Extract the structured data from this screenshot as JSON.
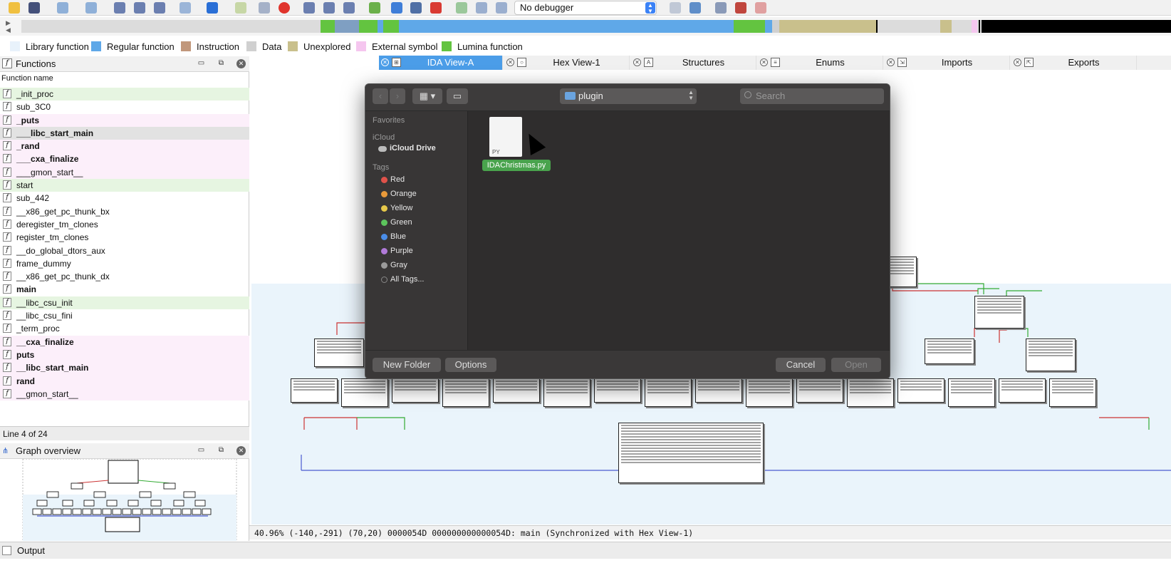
{
  "toolbar": {
    "debugger_select": "No debugger",
    "icons": [
      "open-icon",
      "save-icon",
      "back-icon",
      "forward-icon",
      "toolbar-action-icon",
      "run-icon",
      "pause-icon",
      "stop-icon",
      "breakpoint-icon"
    ]
  },
  "legend": [
    {
      "label": "Library function",
      "color": "#e8f2fb"
    },
    {
      "label": "Regular function",
      "color": "#5fa8e8"
    },
    {
      "label": "Instruction",
      "color": "#c1977b"
    },
    {
      "label": "Data",
      "color": "#d0d0d0"
    },
    {
      "label": "Unexplored",
      "color": "#c9c08c"
    },
    {
      "label": "External symbol",
      "color": "#f5c6ef"
    },
    {
      "label": "Lumina function",
      "color": "#63c440"
    }
  ],
  "functions_panel": {
    "title": "Functions",
    "column_header": "Function name",
    "items": [
      {
        "name": "_init_proc",
        "kind": "lib"
      },
      {
        "name": "sub_3C0",
        "kind": "plain"
      },
      {
        "name": "_puts",
        "kind": "imp_bold"
      },
      {
        "name": "___libc_start_main",
        "kind": "sel_bold"
      },
      {
        "name": "_rand",
        "kind": "imp_bold"
      },
      {
        "name": "___cxa_finalize",
        "kind": "imp_bold"
      },
      {
        "name": "___gmon_start__",
        "kind": "imp"
      },
      {
        "name": "start",
        "kind": "lib"
      },
      {
        "name": "sub_442",
        "kind": "plain"
      },
      {
        "name": "__x86_get_pc_thunk_bx",
        "kind": "plain"
      },
      {
        "name": "deregister_tm_clones",
        "kind": "plain"
      },
      {
        "name": "register_tm_clones",
        "kind": "plain"
      },
      {
        "name": "__do_global_dtors_aux",
        "kind": "plain"
      },
      {
        "name": "frame_dummy",
        "kind": "plain"
      },
      {
        "name": "__x86_get_pc_thunk_dx",
        "kind": "plain"
      },
      {
        "name": "main",
        "kind": "bold"
      },
      {
        "name": "__libc_csu_init",
        "kind": "lib"
      },
      {
        "name": "__libc_csu_fini",
        "kind": "plain"
      },
      {
        "name": "_term_proc",
        "kind": "plain"
      },
      {
        "name": "__cxa_finalize",
        "kind": "imp_bold"
      },
      {
        "name": "puts",
        "kind": "imp_bold"
      },
      {
        "name": "__libc_start_main",
        "kind": "imp_bold"
      },
      {
        "name": "rand",
        "kind": "imp_bold"
      },
      {
        "name": "__gmon_start__",
        "kind": "imp"
      }
    ],
    "status": "Line 4 of 24"
  },
  "graph_overview": {
    "title": "Graph overview"
  },
  "tabs": [
    {
      "label": "IDA View-A",
      "active": true
    },
    {
      "label": "Hex View-1",
      "active": false
    },
    {
      "label": "Structures",
      "active": false
    },
    {
      "label": "Enums",
      "active": false
    },
    {
      "label": "Imports",
      "active": false
    },
    {
      "label": "Exports",
      "active": false
    }
  ],
  "status_line": "40.96% (-140,-291) (70,20) 0000054D 000000000000054D: main (Synchronized with Hex View-1)",
  "output": {
    "label": "Output"
  },
  "dialog": {
    "location": "plugin",
    "search_placeholder": "Search",
    "sidebar": {
      "favorites_heading": "Favorites",
      "icloud_heading": "iCloud",
      "icloud_drive": "iCloud Drive",
      "tags_heading": "Tags",
      "tags": [
        {
          "label": "Red",
          "color": "#e0524a"
        },
        {
          "label": "Orange",
          "color": "#e99a3a"
        },
        {
          "label": "Yellow",
          "color": "#e6c84a"
        },
        {
          "label": "Green",
          "color": "#5cc45c"
        },
        {
          "label": "Blue",
          "color": "#4a8de8"
        },
        {
          "label": "Purple",
          "color": "#b07ad8"
        },
        {
          "label": "Gray",
          "color": "#9a9a9a"
        }
      ],
      "all_tags": "All Tags..."
    },
    "file": {
      "name": "IDAChristmas.py",
      "badge": "PY"
    },
    "buttons": {
      "new_folder": "New Folder",
      "options": "Options",
      "cancel": "Cancel",
      "open": "Open"
    }
  }
}
